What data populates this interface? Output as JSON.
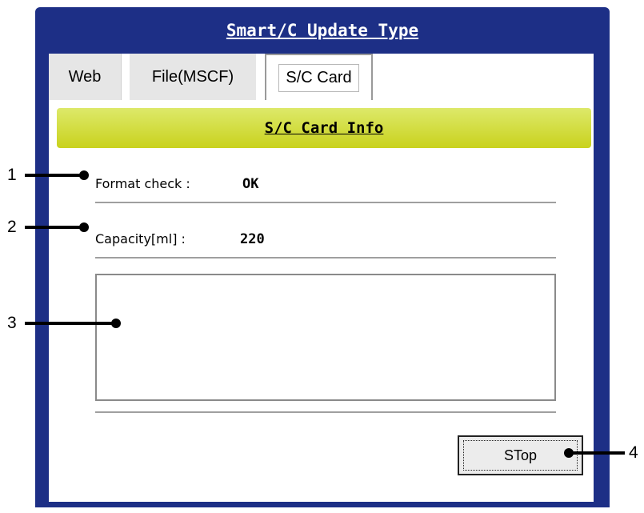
{
  "window": {
    "title": "Smart/C Update Type"
  },
  "tabs": [
    {
      "label": "Web"
    },
    {
      "label": "File(MSCF)"
    },
    {
      "label": "S/C Card"
    }
  ],
  "section": {
    "title": "S/C Card Info"
  },
  "info": {
    "format_label": "Format check :",
    "format_value": "OK",
    "capacity_label": "Capacity[ml] :",
    "capacity_value": "220"
  },
  "message_area": {
    "value": ""
  },
  "buttons": {
    "stop_label": "STop"
  },
  "callouts": {
    "c1": "1",
    "c2": "2",
    "c3": "3",
    "c4": "4"
  }
}
